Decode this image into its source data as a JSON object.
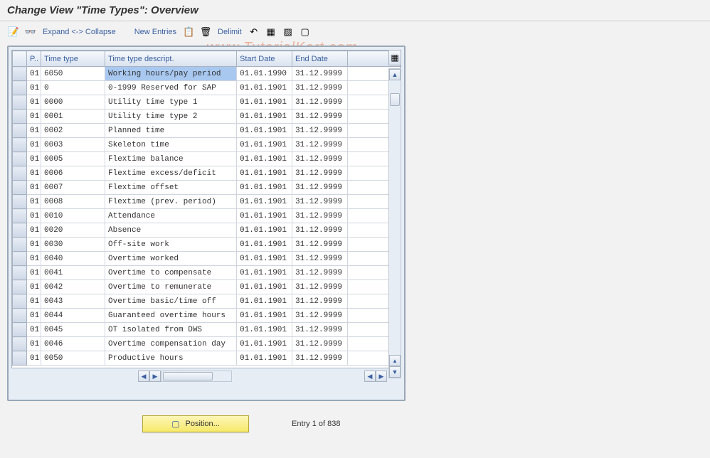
{
  "title": "Change View \"Time Types\": Overview",
  "toolbar": {
    "expand_collapse": "Expand <-> Collapse",
    "new_entries": "New Entries",
    "delimit": "Delimit"
  },
  "columns": {
    "p": "P..",
    "time_type": "Time type",
    "desc": "Time type descript.",
    "start": "Start Date",
    "end": "End Date"
  },
  "rows": [
    {
      "p": "01",
      "tt": "6050",
      "desc": "Working hours/pay period",
      "sd": "01.01.1990",
      "ed": "31.12.9999",
      "sel": true
    },
    {
      "p": "01",
      "tt": "0",
      "desc": "0-1999 Reserved for SAP",
      "sd": "01.01.1901",
      "ed": "31.12.9999"
    },
    {
      "p": "01",
      "tt": "0000",
      "desc": "Utility time type 1",
      "sd": "01.01.1901",
      "ed": "31.12.9999"
    },
    {
      "p": "01",
      "tt": "0001",
      "desc": "Utility time type 2",
      "sd": "01.01.1901",
      "ed": "31.12.9999"
    },
    {
      "p": "01",
      "tt": "0002",
      "desc": "Planned time",
      "sd": "01.01.1901",
      "ed": "31.12.9999"
    },
    {
      "p": "01",
      "tt": "0003",
      "desc": "Skeleton time",
      "sd": "01.01.1901",
      "ed": "31.12.9999"
    },
    {
      "p": "01",
      "tt": "0005",
      "desc": "Flextime balance",
      "sd": "01.01.1901",
      "ed": "31.12.9999"
    },
    {
      "p": "01",
      "tt": "0006",
      "desc": "Flextime excess/deficit",
      "sd": "01.01.1901",
      "ed": "31.12.9999"
    },
    {
      "p": "01",
      "tt": "0007",
      "desc": "Flextime offset",
      "sd": "01.01.1901",
      "ed": "31.12.9999"
    },
    {
      "p": "01",
      "tt": "0008",
      "desc": "Flextime (prev. period)",
      "sd": "01.01.1901",
      "ed": "31.12.9999"
    },
    {
      "p": "01",
      "tt": "0010",
      "desc": "Attendance",
      "sd": "01.01.1901",
      "ed": "31.12.9999"
    },
    {
      "p": "01",
      "tt": "0020",
      "desc": "Absence",
      "sd": "01.01.1901",
      "ed": "31.12.9999"
    },
    {
      "p": "01",
      "tt": "0030",
      "desc": "Off-site work",
      "sd": "01.01.1901",
      "ed": "31.12.9999"
    },
    {
      "p": "01",
      "tt": "0040",
      "desc": "Overtime worked",
      "sd": "01.01.1901",
      "ed": "31.12.9999"
    },
    {
      "p": "01",
      "tt": "0041",
      "desc": "Overtime to compensate",
      "sd": "01.01.1901",
      "ed": "31.12.9999"
    },
    {
      "p": "01",
      "tt": "0042",
      "desc": "Overtime to remunerate",
      "sd": "01.01.1901",
      "ed": "31.12.9999"
    },
    {
      "p": "01",
      "tt": "0043",
      "desc": "Overtime basic/time off",
      "sd": "01.01.1901",
      "ed": "31.12.9999"
    },
    {
      "p": "01",
      "tt": "0044",
      "desc": "Guaranteed overtime hours",
      "sd": "01.01.1901",
      "ed": "31.12.9999"
    },
    {
      "p": "01",
      "tt": "0045",
      "desc": "OT isolated from DWS",
      "sd": "01.01.1901",
      "ed": "31.12.9999"
    },
    {
      "p": "01",
      "tt": "0046",
      "desc": "Overtime compensation day",
      "sd": "01.01.1901",
      "ed": "31.12.9999"
    },
    {
      "p": "01",
      "tt": "0050",
      "desc": "Productive hours",
      "sd": "01.01.1901",
      "ed": "31.12.9999"
    }
  ],
  "footer": {
    "position": "Position...",
    "status": "Entry 1 of 838"
  },
  "watermark": "www.TutorialKart.com"
}
